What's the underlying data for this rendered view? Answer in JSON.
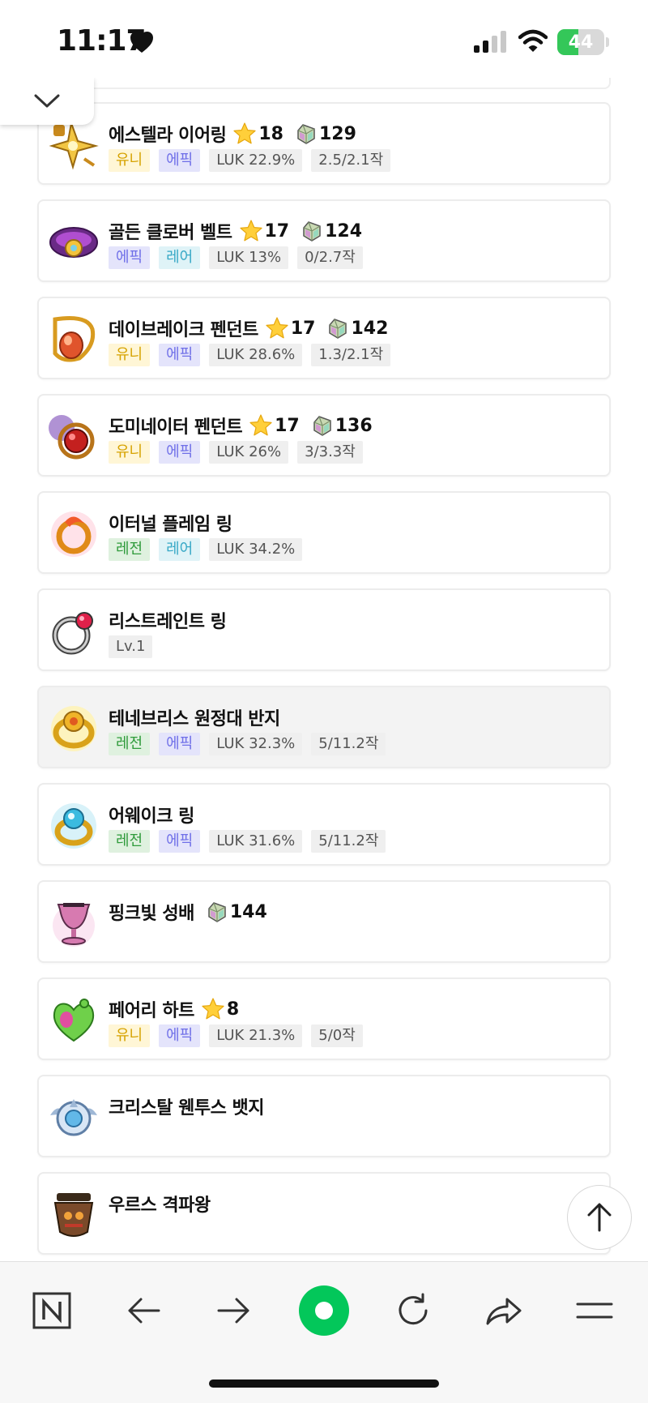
{
  "status_bar": {
    "time": "11:17",
    "battery": "44",
    "battery_level": 0.44
  },
  "items": [
    {
      "name": "에스텔라 이어링",
      "icon": "estella-earring-icon",
      "star": "18",
      "gem": "129",
      "tags": [
        {
          "text": "유니",
          "kind": "unique"
        },
        {
          "text": "에픽",
          "kind": "epic"
        },
        {
          "text": "LUK 22.9%",
          "kind": "stat"
        },
        {
          "text": "2.5/2.1작",
          "kind": "stat"
        }
      ]
    },
    {
      "name": "골든 클로버 벨트",
      "icon": "golden-clover-belt-icon",
      "star": "17",
      "gem": "124",
      "tags": [
        {
          "text": "에픽",
          "kind": "epic"
        },
        {
          "text": "레어",
          "kind": "rare"
        },
        {
          "text": "LUK 13%",
          "kind": "stat"
        },
        {
          "text": "0/2.7작",
          "kind": "stat"
        }
      ]
    },
    {
      "name": "데이브레이크 펜던트",
      "icon": "daybreak-pendant-icon",
      "star": "17",
      "gem": "142",
      "tags": [
        {
          "text": "유니",
          "kind": "unique"
        },
        {
          "text": "에픽",
          "kind": "epic"
        },
        {
          "text": "LUK 28.6%",
          "kind": "stat"
        },
        {
          "text": "1.3/2.1작",
          "kind": "stat"
        }
      ]
    },
    {
      "name": "도미네이터 펜던트",
      "icon": "dominator-pendant-icon",
      "star": "17",
      "gem": "136",
      "tags": [
        {
          "text": "유니",
          "kind": "unique"
        },
        {
          "text": "에픽",
          "kind": "epic"
        },
        {
          "text": "LUK 26%",
          "kind": "stat"
        },
        {
          "text": "3/3.3작",
          "kind": "stat"
        }
      ]
    },
    {
      "name": "이터널 플레임 링",
      "icon": "eternal-flame-ring-icon",
      "tags": [
        {
          "text": "레전",
          "kind": "legendary"
        },
        {
          "text": "레어",
          "kind": "rare"
        },
        {
          "text": "LUK 34.2%",
          "kind": "stat"
        }
      ]
    },
    {
      "name": "리스트레인트 링",
      "icon": "restraint-ring-icon",
      "tags": [
        {
          "text": "Lv.1",
          "kind": "stat"
        }
      ]
    },
    {
      "name": "테네브리스 원정대 반지",
      "icon": "tenebris-ring-icon",
      "highlight": true,
      "tags": [
        {
          "text": "레전",
          "kind": "legendary"
        },
        {
          "text": "에픽",
          "kind": "epic"
        },
        {
          "text": "LUK 32.3%",
          "kind": "stat"
        },
        {
          "text": "5/11.2작",
          "kind": "stat"
        }
      ]
    },
    {
      "name": "어웨이크 링",
      "icon": "awake-ring-icon",
      "tags": [
        {
          "text": "레전",
          "kind": "legendary"
        },
        {
          "text": "에픽",
          "kind": "epic"
        },
        {
          "text": "LUK 31.6%",
          "kind": "stat"
        },
        {
          "text": "5/11.2작",
          "kind": "stat"
        }
      ]
    },
    {
      "name": "핑크빛 성배",
      "icon": "pink-holy-cup-icon",
      "gem": "144",
      "tags": []
    },
    {
      "name": "페어리 하트",
      "icon": "fairy-heart-icon",
      "star": "8",
      "tags": [
        {
          "text": "유니",
          "kind": "unique"
        },
        {
          "text": "에픽",
          "kind": "epic"
        },
        {
          "text": "LUK 21.3%",
          "kind": "stat"
        },
        {
          "text": "5/0작",
          "kind": "stat"
        }
      ]
    },
    {
      "name": "크리스탈 웬투스 뱃지",
      "icon": "crystal-ventus-badge-icon",
      "tags": []
    },
    {
      "name": "우르스 격파왕",
      "icon": "urus-medal-icon",
      "tags": []
    }
  ],
  "toolbar": {
    "buttons": [
      "naver-n-icon",
      "back-arrow-icon",
      "forward-arrow-icon",
      "green-dot-home-icon",
      "refresh-icon",
      "share-icon",
      "menu-icon"
    ]
  },
  "colors": {
    "accent_green": "#03c75a",
    "battery_green": "#34c759",
    "unique": "#d6a200",
    "epic": "#6f6fe8",
    "rare": "#37a8c6",
    "legendary": "#2f9b3b"
  }
}
